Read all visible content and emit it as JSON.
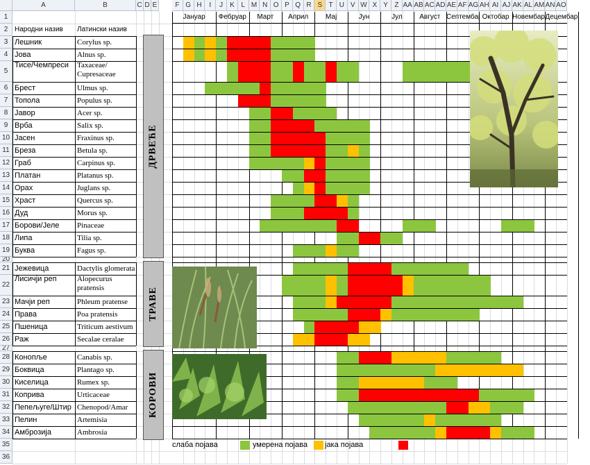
{
  "app": "spreadsheet",
  "selected_column": "S",
  "columns": [
    "A",
    "B",
    "C",
    "D",
    "E",
    "F",
    "G",
    "H",
    "I",
    "J",
    "K",
    "L",
    "M",
    "N",
    "O",
    "P",
    "Q",
    "R",
    "S",
    "T",
    "U",
    "V",
    "W",
    "X",
    "Y",
    "Z",
    "AA",
    "AB",
    "AC",
    "AD",
    "AE",
    "AF",
    "AG",
    "AH",
    "AI",
    "AJ",
    "AK",
    "AL",
    "AM",
    "AN",
    "AO"
  ],
  "row_numbers": [
    "1",
    "2",
    "3",
    "4",
    "5",
    "6",
    "7",
    "8",
    "9",
    "10",
    "11",
    "12",
    "13",
    "14",
    "15",
    "16",
    "17",
    "18",
    "19",
    "20",
    "21",
    "22",
    "23",
    "24",
    "25",
    "26",
    "27",
    "28",
    "29",
    "30",
    "31",
    "32",
    "33",
    "34",
    "35",
    "36"
  ],
  "headers": {
    "common": "Народни назив",
    "latin": "Латински назив"
  },
  "months": [
    "Јануар",
    "Фебруар",
    "Март",
    "Април",
    "Мај",
    "Јун",
    "Јул",
    "Август",
    "Септембар",
    "Октобар",
    "Новембар",
    "Децембар"
  ],
  "colors": {
    "weak": "#ffffff",
    "moderate": "#8cc63f",
    "strong": "#ffc000",
    "very_strong": "#ff0000"
  },
  "sections": [
    {
      "label": "ДРВЕЋЕ",
      "image": "tree-photo"
    },
    {
      "label": "ТРАВЕ",
      "image": "grass-photo"
    },
    {
      "label": "КОРОВИ",
      "image": "weed-photo"
    }
  ],
  "rows": [
    {
      "row": 3,
      "name": "Лешник",
      "latin": "Corylus sp.",
      "season": "1,2,1,2,3,3,3,3,2,2,2,2"
    },
    {
      "row": 4,
      "name": "Јова",
      "latin": "Alnus sp.",
      "season": "1,2,1,2,3,3,3,3,2,2,2,2"
    },
    {
      "row": 5,
      "name": "Тисе/Чемпреси",
      "latin": "Taxaceae/ Cupresaceae",
      "season": "0,0,0,0,2,3,3,3,2,2,3,2,2,3,2,2,0,0,0,0,2,2,2,2,2,2,2"
    },
    {
      "row": 6,
      "name": "Брест",
      "latin": "Ulmus sp.",
      "season": "0,0,2,2,2,2,2,3,2,2,2,2,2"
    },
    {
      "row": 7,
      "name": "Топола",
      "latin": "Populus sp.",
      "season": "0,0,0,0,0,3,3,3,2,2,2,2,2"
    },
    {
      "row": 8,
      "name": "Јавор",
      "latin": "Acer sp.",
      "season": "0,0,0,0,0,0,2,2,3,3,2,2,2,2"
    },
    {
      "row": 9,
      "name": "Врба",
      "latin": "Salix sp.",
      "season": "0,0,0,0,0,0,2,2,3,3,3,3,2,2,2,2,2"
    },
    {
      "row": 10,
      "name": "Јасен",
      "latin": "Fraxinus sp.",
      "season": "0,0,0,0,0,0,2,2,3,3,3,3,3,2,2,2,2"
    },
    {
      "row": 11,
      "name": "Бреза",
      "latin": "Betula sp.",
      "season": "0,0,0,0,0,0,2,2,3,3,3,3,3,2,2,1,2"
    },
    {
      "row": 12,
      "name": "Граб",
      "latin": "Carpinus sp.",
      "season": "0,0,0,0,0,0,2,2,2,2,2,1,3,2,2,2,2"
    },
    {
      "row": 13,
      "name": "Платан",
      "latin": "Platanus sp.",
      "season": "0,0,0,0,0,0,0,0,0,2,2,3,3,2,2,2,2"
    },
    {
      "row": 14,
      "name": "Орах",
      "latin": "Juglans sp.",
      "season": "0,0,0,0,0,0,0,0,0,0,2,1,3,2,2,2,2"
    },
    {
      "row": 15,
      "name": "Храст",
      "latin": "Quercus sp.",
      "season": "0,0,0,0,0,0,0,0,2,2,2,2,3,3,1,2,0"
    },
    {
      "row": 16,
      "name": "Дуд",
      "latin": "Morus sp.",
      "season": "0,0,0,0,0,0,0,0,2,2,2,3,3,3,3,2,0"
    },
    {
      "row": 17,
      "name": "Борови/Јеле",
      "latin": "Pinaceae",
      "season": "0,0,0,0,0,0,0,2,2,2,2,2,2,2,3,3,0,0,0,0,2,2,2,0,0,0,0,0,0,2,2,2"
    },
    {
      "row": 18,
      "name": "Липа",
      "latin": "Tilia sp.",
      "season": "0,0,0,0,0,0,0,0,0,0,0,0,0,0,2,2,3,3,2,2"
    },
    {
      "row": 19,
      "name": "Буква",
      "latin": "Fagus sp.",
      "season": "0,0,0,0,0,0,0,0,0,0,2,2,2,1,2,2"
    },
    {
      "row": 21,
      "name": "Јежевица",
      "latin": "Dactylis glomerata",
      "season": "0,0,0,0,0,0,0,0,0,0,2,2,2,2,2,3,3,3,3,2,2,2,2,2,2,2"
    },
    {
      "row": 22,
      "name": "Лисичји реп",
      "latin": "Alopecurus pratensis",
      "season": "0,0,0,0,0,0,0,0,0,2,2,2,2,1,2,3,3,3,3,3,1,2,2,2,2,2,2,2"
    },
    {
      "row": 23,
      "name": "Мачји реп",
      "latin": "Phleum pratense",
      "season": "0,0,0,0,0,0,0,0,0,0,2,2,2,1,3,3,3,3,3,2,2,2,2,2,2,2,2,2,2,2,2"
    },
    {
      "row": 24,
      "name": "Права ливадарка",
      "latin": "Poa pratensis",
      "season": "0,0,0,0,0,0,0,0,0,0,2,2,2,2,2,3,3,3,1,2,2,2,2,2,2,2,2"
    },
    {
      "row": 25,
      "name": "Пшеница",
      "latin": "Triticum aestivum",
      "season": "0,0,0,0,0,0,0,0,0,0,0,2,3,3,3,3,1,1"
    },
    {
      "row": 26,
      "name": "Раж",
      "latin": "Secalae ceralae",
      "season": "0,0,0,0,0,0,0,0,0,0,1,1,3,3,3,1,1"
    },
    {
      "row": 28,
      "name": "Конопље",
      "latin": "Canabis sp.",
      "season": "0,0,0,0,0,0,0,0,0,0,0,0,0,0,2,2,3,3,3,1,1,1,1,1,2,2,2,2,2"
    },
    {
      "row": 29,
      "name": "Боквица",
      "latin": "Plantago sp.",
      "season": "0,0,0,0,0,0,0,0,0,0,0,0,0,0,2,2,2,2,2,2,2,2,2,1,1,1,1,1,1,1,1"
    },
    {
      "row": 30,
      "name": "Киселица",
      "latin": "Rumex sp.",
      "season": "0,0,0,0,0,0,0,0,0,0,0,0,0,0,2,2,1,1,1,1,1,1,2,2,2"
    },
    {
      "row": 31,
      "name": "Коприва",
      "latin": "Urticaceae",
      "season": "0,0,0,0,0,0,0,0,0,0,0,0,0,0,2,2,3,3,3,3,3,3,3,3,3,3,3,2,2,2,2,2"
    },
    {
      "row": 32,
      "name": "Пепељуге/Штир",
      "latin": "Chenopod/Amar",
      "season": "0,0,0,0,0,0,0,0,0,0,0,0,0,0,0,2,2,2,2,2,2,2,2,2,3,3,1,1,2,2,2"
    },
    {
      "row": 33,
      "name": "Пелин",
      "latin": "Artemisia",
      "season": "0,0,0,0,0,0,0,0,0,0,0,0,0,0,0,0,2,2,2,2,2,2,1,2,2,2,2,2,2"
    },
    {
      "row": 34,
      "name": "Амброзија",
      "latin": "Ambrosia",
      "season": "0,0,0,0,0,0,0,0,0,0,0,0,0,0,0,0,0,2,2,2,2,2,2,1,3,3,3,3,1,2,2,2"
    }
  ],
  "legend": [
    {
      "label": "слаба појава",
      "level": "weak"
    },
    {
      "label": "умерена појава",
      "level": "moderate"
    },
    {
      "label": "јака појава",
      "level": "strong"
    },
    {
      "label": "",
      "level": "very_strong"
    }
  ]
}
